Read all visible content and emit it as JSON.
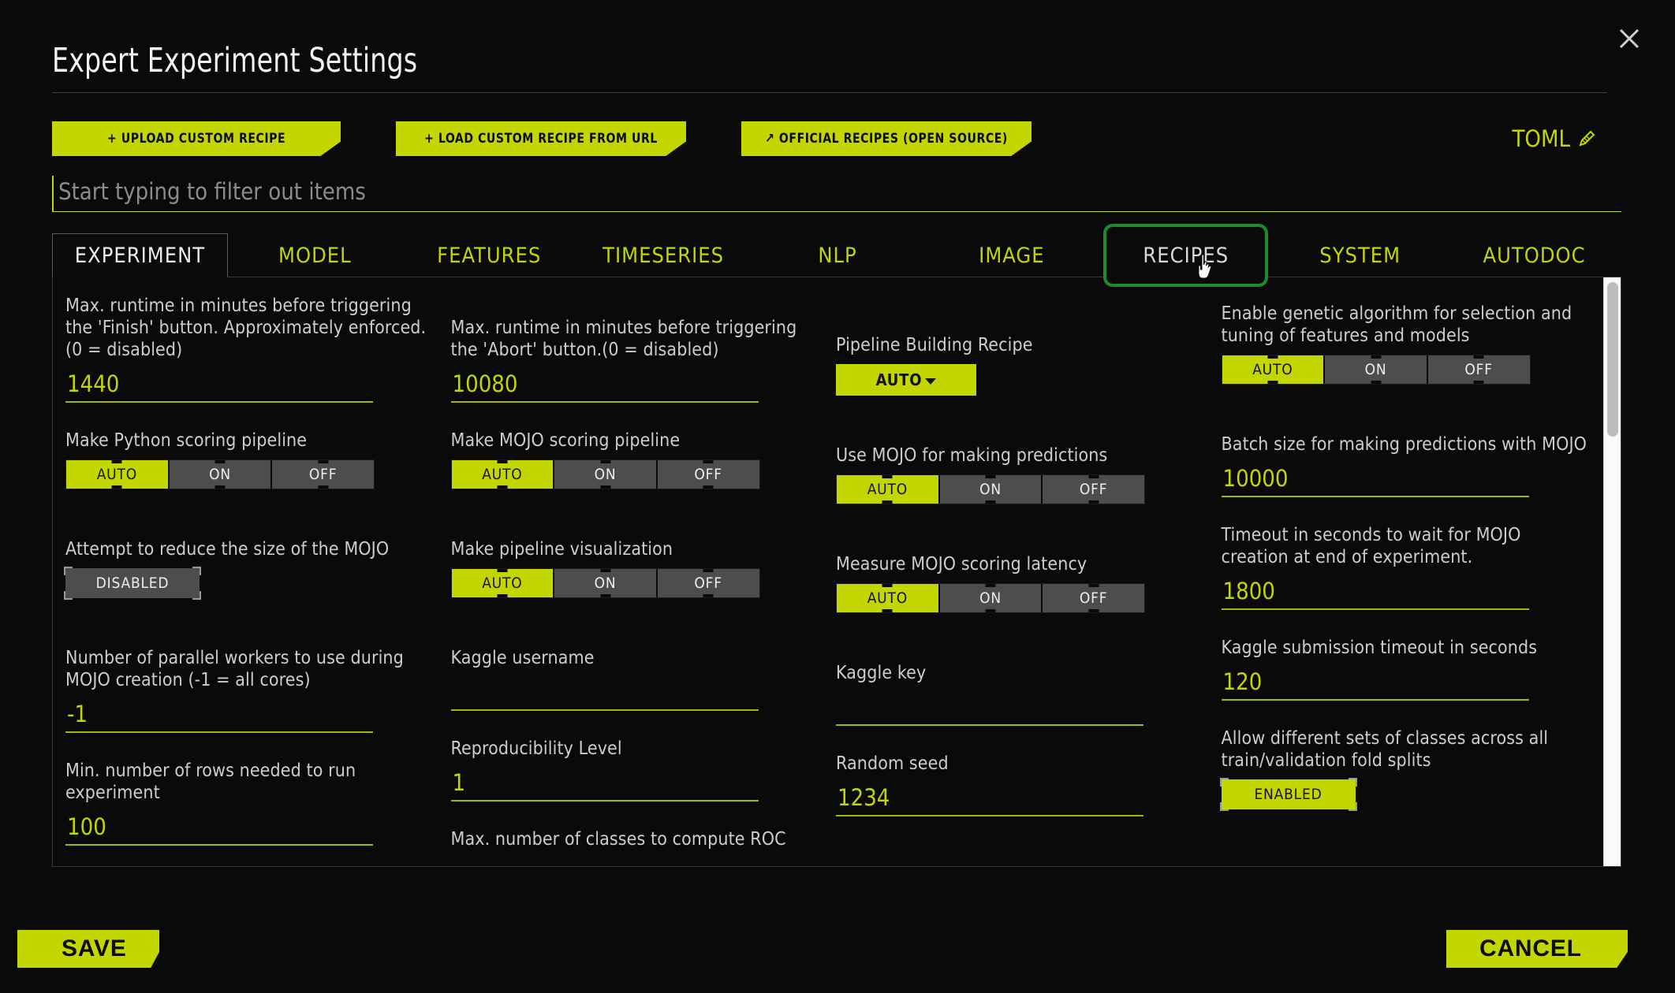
{
  "dialog": {
    "title": "Expert Experiment Settings",
    "close_icon": "close-icon"
  },
  "toolbar": {
    "upload_recipe": "+ UPLOAD CUSTOM RECIPE",
    "load_recipe_url": "+ LOAD CUSTOM RECIPE FROM URL",
    "official_recipes": "↗ OFFICIAL RECIPES (OPEN SOURCE)",
    "toml_label": "TOML",
    "toml_icon": "pencil-icon"
  },
  "search": {
    "placeholder": "Start typing to filter out items",
    "value": ""
  },
  "tabs": [
    {
      "label": "EXPERIMENT",
      "state": "active"
    },
    {
      "label": "MODEL",
      "state": "normal"
    },
    {
      "label": "FEATURES",
      "state": "normal"
    },
    {
      "label": "TIMESERIES",
      "state": "normal"
    },
    {
      "label": "NLP",
      "state": "normal"
    },
    {
      "label": "IMAGE",
      "state": "normal"
    },
    {
      "label": "RECIPES",
      "state": "focused"
    },
    {
      "label": "SYSTEM",
      "state": "normal"
    },
    {
      "label": "AUTODOC",
      "state": "normal"
    }
  ],
  "columns": [
    {
      "fields": [
        {
          "type": "text",
          "label": "Max. runtime in minutes before triggering the 'Finish' button. Approximately enforced. (0 = disabled)",
          "value": "1440"
        },
        {
          "type": "segmented",
          "label": "Make Python scoring pipeline",
          "options": [
            "AUTO",
            "ON",
            "OFF"
          ],
          "selected": "AUTO"
        },
        {
          "type": "bracket",
          "label": "Attempt to reduce the size of the MOJO",
          "value": "DISABLED",
          "enabled": false
        },
        {
          "type": "text",
          "label": "Number of parallel workers to use during MOJO creation (-1 = all cores)",
          "value": "-1"
        },
        {
          "type": "text",
          "label": "Min. number of rows needed to run experiment",
          "value": "100"
        }
      ]
    },
    {
      "fields": [
        {
          "type": "text",
          "label": "Max. runtime in minutes before triggering the 'Abort' button.(0 = disabled)",
          "value": "10080"
        },
        {
          "type": "segmented",
          "label": "Make MOJO scoring pipeline",
          "options": [
            "AUTO",
            "ON",
            "OFF"
          ],
          "selected": "AUTO"
        },
        {
          "type": "segmented",
          "label": "Make pipeline visualization",
          "options": [
            "AUTO",
            "ON",
            "OFF"
          ],
          "selected": "AUTO"
        },
        {
          "type": "text",
          "label": "Kaggle username",
          "value": ""
        },
        {
          "type": "text",
          "label": "Reproducibility Level",
          "value": "1"
        },
        {
          "type": "cutoff",
          "label": "Max. number of classes to compute ROC"
        }
      ]
    },
    {
      "fields": [
        {
          "type": "dropdown",
          "label": "Pipeline Building Recipe",
          "value": "AUTO"
        },
        {
          "type": "segmented",
          "label": "Use MOJO for making predictions",
          "options": [
            "AUTO",
            "ON",
            "OFF"
          ],
          "selected": "AUTO"
        },
        {
          "type": "segmented",
          "label": "Measure MOJO scoring latency",
          "options": [
            "AUTO",
            "ON",
            "OFF"
          ],
          "selected": "AUTO"
        },
        {
          "type": "text",
          "label": "Kaggle key",
          "value": ""
        },
        {
          "type": "text",
          "label": "Random seed",
          "value": "1234"
        }
      ]
    },
    {
      "fields": [
        {
          "type": "segmented",
          "label": "Enable genetic algorithm for selection and tuning of features and models",
          "options": [
            "AUTO",
            "ON",
            "OFF"
          ],
          "selected": "AUTO"
        },
        {
          "type": "text",
          "label": "Batch size for making predictions with MOJO",
          "value": "10000"
        },
        {
          "type": "text",
          "label": "Timeout in seconds to wait for MOJO creation at end of experiment.",
          "value": "1800"
        },
        {
          "type": "text",
          "label": "Kaggle submission timeout in seconds",
          "value": "120"
        },
        {
          "type": "bracket",
          "label": "Allow different sets of classes across all train/validation fold splits",
          "value": "ENABLED",
          "enabled": true
        }
      ]
    }
  ],
  "footer": {
    "save": "SAVE",
    "cancel": "CANCEL"
  },
  "colors": {
    "accent": "#c4d600",
    "focus_ring": "#1f8a28",
    "background": "#0a0a0a",
    "toggle_off": "#4d4d4d"
  }
}
